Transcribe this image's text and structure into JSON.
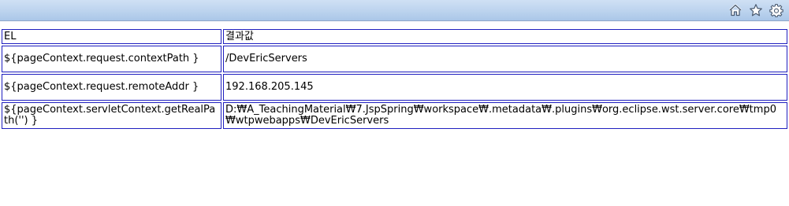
{
  "toolbar": {
    "icons": [
      "home-icon",
      "star-icon",
      "gear-icon"
    ],
    "colors": {
      "gradient_top": "#cfe0f4",
      "gradient_bottom": "#aac7e8"
    }
  },
  "table": {
    "border_color": "#1f1fbf",
    "header": {
      "el": "EL",
      "result": "결과값"
    },
    "rows": [
      {
        "el": "${pageContext.request.contextPath }",
        "result": "/DevEricServers"
      },
      {
        "el": "${pageContext.request.remoteAddr }",
        "result": "192.168.205.145"
      },
      {
        "el": "${pageContext.servletContext.getRealPath('') }",
        "result": "D:₩A_TeachingMaterial₩7.JspSpring₩workspace₩.metadata₩.plugins₩org.eclipse.wst.server.core₩tmp0₩wtpwebapps₩DevEricServers"
      }
    ]
  }
}
